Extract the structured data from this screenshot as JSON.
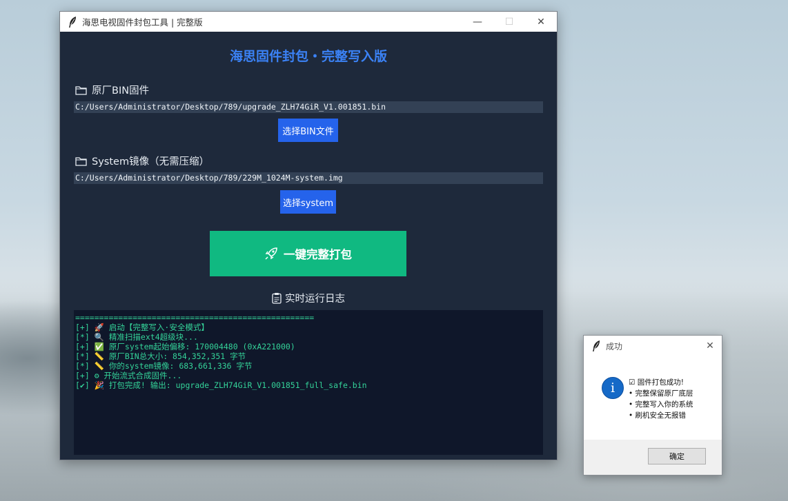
{
  "window": {
    "title": "海思电视固件封包工具 | 完整版",
    "minimize": "—",
    "maximize": "☐",
    "close": "✕"
  },
  "app": {
    "heading": "海思固件封包・完整写入版",
    "bin_section": {
      "icon": "folder-icon",
      "label": "原厂BIN固件",
      "path": "C:/Users/Administrator/Desktop/789/upgrade_ZLH74GiR_V1.001851.bin",
      "button": "选择BIN文件"
    },
    "system_section": {
      "icon": "folder-icon",
      "label": "System镜像（无需压缩）",
      "path": "C:/Users/Administrator/Desktop/789/229M_1024M-system.img",
      "button": "选择system"
    },
    "pack_button": {
      "icon": "rocket-icon",
      "label": "一键完整打包"
    },
    "log_title": {
      "icon": "clipboard-icon",
      "label": "实时运行日志"
    },
    "log_lines": [
      "==================================================",
      "[+] 🚀 启动【完整写入·安全模式】",
      "[*] 🔍 精准扫描ext4超级块...",
      "[+] ✅ 原厂system起始偏移: 170004480 (0xA221000)",
      "[*] 📏 原厂BIN总大小: 854,352,351 字节",
      "[*] 📏 你的system镜像: 683,661,336 字节",
      "[+] ⚙ 开始流式合成固件...",
      "[✔] 🎉 打包完成! 输出: upgrade_ZLH74GiR_V1.001851_full_safe.bin"
    ]
  },
  "dialog": {
    "title": "成功",
    "close": "✕",
    "icon": "info-icon",
    "message": [
      "☑ 固件打包成功!",
      "• 完整保留原厂底层",
      "• 完整写入你的系统",
      "• 刷机安全无报错"
    ],
    "ok_button": "确定"
  },
  "colors": {
    "window_bg": "#1e293b",
    "heading": "#3b82f6",
    "pick_button": "#2563eb",
    "pack_button": "#10b981",
    "log_bg": "#0f172a",
    "log_text": "#34d399"
  }
}
